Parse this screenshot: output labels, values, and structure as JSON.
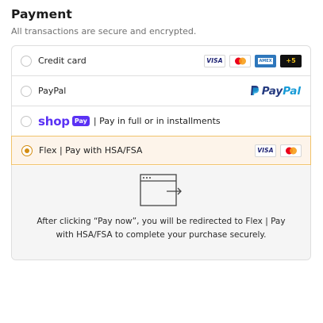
{
  "payment": {
    "title": "Payment",
    "subtitle": "All transactions are secure and encrypted."
  },
  "methods": {
    "credit_card": {
      "label": "Credit card",
      "selected": false,
      "card_icons": [
        "visa-icon",
        "mastercard-icon",
        "amex-icon"
      ],
      "visa_text": "VISA",
      "amex_text": "AMEX",
      "more_badge": "+5"
    },
    "paypal": {
      "label": "PayPal",
      "selected": false,
      "logo_text_pay": "Pay",
      "logo_text_pal": "Pal"
    },
    "shop_pay": {
      "logo_shop": "shop",
      "logo_pay": "Pay",
      "label": "| Pay in full or in installments",
      "selected": false
    },
    "flex": {
      "label": "Flex | Pay with HSA/FSA",
      "selected": true,
      "visa_text": "VISA",
      "card_icons": [
        "visa-icon",
        "mastercard-icon"
      ],
      "redirect_icon": "browser-redirect-icon",
      "redirect_message": "After clicking “Pay now”, you will be redirected to Flex | Pay with HSA/FSA to complete your purchase securely."
    }
  },
  "colors": {
    "accent": "#d38d12",
    "selected_bg": "#fdf4ea",
    "selected_border": "#f0c36b",
    "shop_purple": "#5a31f4",
    "paypal_dark": "#253b80",
    "paypal_light": "#179bd7"
  }
}
